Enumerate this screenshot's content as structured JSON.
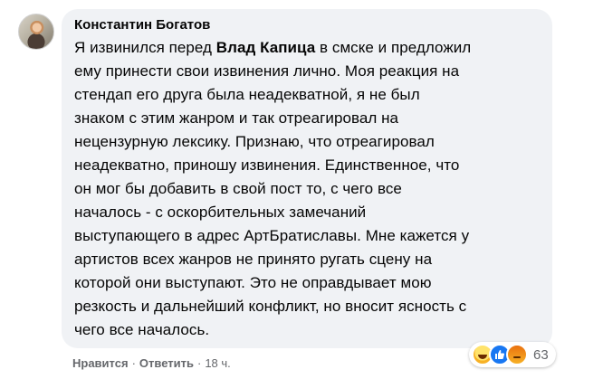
{
  "comment": {
    "author": "Константин Богатов",
    "text_before_mention": "Я извинился перед ",
    "mention": "Влад Капица",
    "text_after_mention": " в смске и предложил\nему принести свои извинения лично. Моя реакция на\nстендап его друга была неадекватной, я не был\nзнаком с этим жанром и так отреагировал на\nнецензурную лексику. Признаю, что отреагировал\nнеадекватно, приношу извинения. Единственное, что\nон мог бы добавить в свой пост то, с чего все\nначалось - с оскорбительных замечаний\nвыступающего в адрес АртБратиславы. Мне кажется у\nартистов всех жанров не принято ругать сцену на\nкоторой они выступают. Это не оправдывает мою\nрезкость и дальнейший конфликт, но вносит ясность с\nчего все началось."
  },
  "reactions": {
    "icons": [
      "haha-icon",
      "like-icon",
      "angry-icon"
    ],
    "count": "63"
  },
  "actions": {
    "like_label": "Нравится",
    "separator": "·",
    "reply_label": "Ответить",
    "time": "18 ч."
  }
}
